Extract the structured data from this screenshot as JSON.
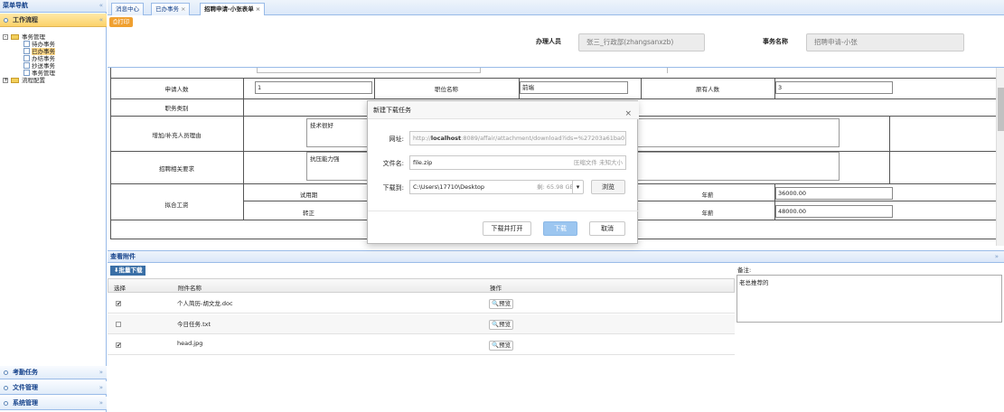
{
  "sidebar": {
    "title": "菜单导航",
    "collapse": "«",
    "active_section": "工作流程",
    "active_chevron": "«",
    "tree": [
      {
        "label": "事务管理"
      },
      {
        "label": "待办事务"
      },
      {
        "label": "已办事务"
      },
      {
        "label": "办结事务"
      },
      {
        "label": "抄送事务"
      },
      {
        "label": "事务管理"
      },
      {
        "label": "流程配置"
      }
    ],
    "tree_toggle_open": "-",
    "tree_toggle_closed": "+",
    "bottom_sections": [
      {
        "label": "考勤任务",
        "chevron": "»"
      },
      {
        "label": "文件管理",
        "chevron": "»"
      },
      {
        "label": "系统管理",
        "chevron": "»"
      }
    ]
  },
  "tabs": [
    {
      "label": "消息中心",
      "close": ""
    },
    {
      "label": "已办事务",
      "close": "×"
    },
    {
      "label": "招聘申请-小张表单",
      "close": "×"
    }
  ],
  "top": {
    "print": "打印",
    "handler_label": "办理人员",
    "handler_value": "张三_行政部(zhangsanxzb)",
    "task_label": "事务名称",
    "task_value": "招聘申请-小张"
  },
  "form": {
    "apply_count_label": "申请人数",
    "apply_count_value": "1",
    "position_label": "职位名称",
    "position_value": "前端",
    "existing_label": "原有人数",
    "existing_value": "3",
    "category_label": "职务类别",
    "reason_label": "增加/补充人员理由",
    "reason_value": "技术很好",
    "requirement_label": "招聘相关要求",
    "requirement_value": "抗压能力强",
    "salary_label": "拟合工资",
    "probation_label": "试用期",
    "regular_label": "转正",
    "annual_label_1": "年薪",
    "annual_value_1": "36000.00",
    "annual_label_2": "年薪",
    "annual_value_2": "48000.00"
  },
  "attach": {
    "header": "查看附件",
    "batch_download": "批量下载",
    "col_select": "选择",
    "col_name": "附件名称",
    "col_action": "操作",
    "files": [
      {
        "name": "个人简历-胡文龙.doc",
        "checked": true,
        "check_mark": "✔",
        "preview": "预览"
      },
      {
        "name": "今日任务.txt",
        "checked": false,
        "check_mark": "",
        "preview": "预览"
      },
      {
        "name": "head.jpg",
        "checked": true,
        "check_mark": "✔",
        "preview": "预览"
      }
    ],
    "note_label": "备注:",
    "note_value": "老总推荐的",
    "expand": "»"
  },
  "modal": {
    "title": "新建下载任务",
    "close": "×",
    "url_label": "网址:",
    "url_prefix": "http://",
    "url_host": "localhost",
    "url_rest": ":8089/affair/attachment/download?ids=%27203a61ba0",
    "filename_label": "文件名:",
    "filename_value": "file.zip",
    "filename_hint": "压缩文件 未知大小",
    "saveto_label": "下载到:",
    "saveto_value": "C:\\Users\\17710\\Desktop",
    "free_space": "剩: 65.98 GB",
    "dropdown": "▾",
    "browse": "浏览",
    "btn_download_open": "下载并打开",
    "btn_download": "下载",
    "btn_cancel": "取消"
  }
}
